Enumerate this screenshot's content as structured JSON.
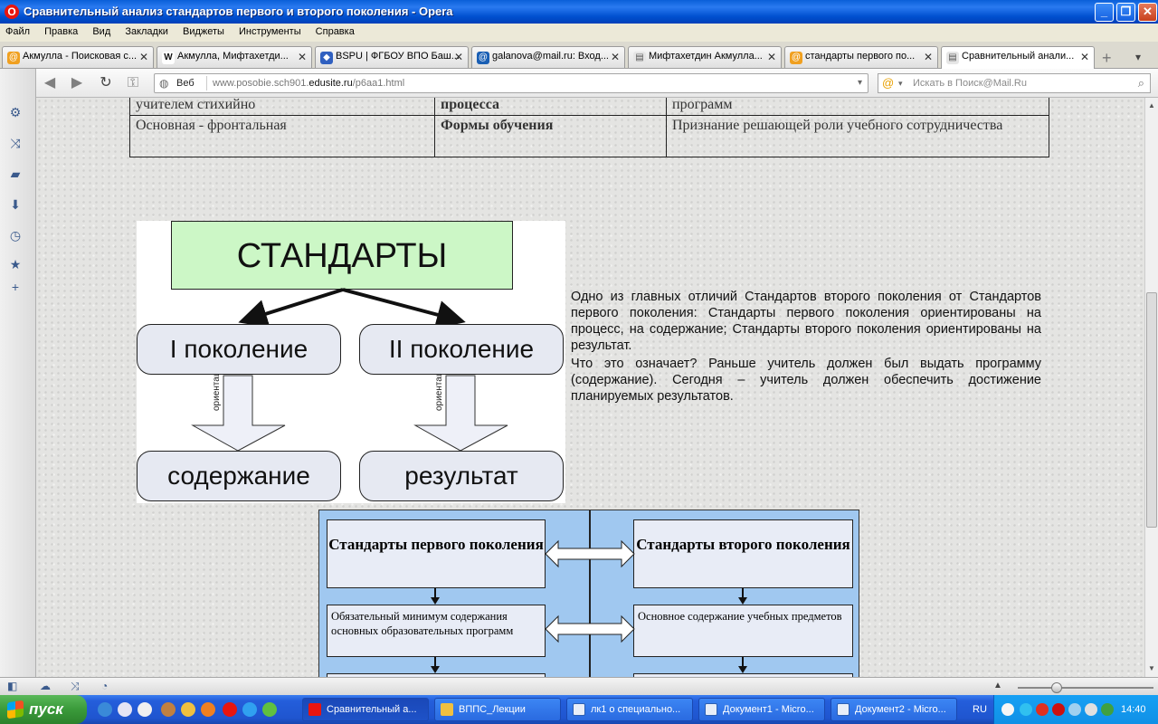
{
  "window": {
    "title": "Сравнительный анализ стандартов первого и второго поколения - Opera"
  },
  "menu": [
    "Файл",
    "Правка",
    "Вид",
    "Закладки",
    "Виджеты",
    "Инструменты",
    "Справка"
  ],
  "tabs": [
    {
      "label": "Акмулла - Поисковая с...",
      "icon_color": "#f0a020"
    },
    {
      "label": "Акмулла, Мифтахетди...",
      "icon_color": "#555555"
    },
    {
      "label": "BSPU | ФГБОУ ВПО Баш...",
      "icon_color": "#3060c0"
    },
    {
      "label": "galanova@mail.ru: Вход...",
      "icon_color": "#1a5fb4"
    },
    {
      "label": "Мифтахетдин Акмулла...",
      "icon_color": "#888888"
    },
    {
      "label": "стандарты первого по...",
      "icon_color": "#f0a020"
    },
    {
      "label": "Сравнительный анали...",
      "icon_color": "#888888"
    }
  ],
  "addressbar": {
    "web_label": "Веб",
    "url_pre": "www.posobie.sch901.",
    "url_host": "edusite.ru",
    "url_post": "/p6aa1.html",
    "search_placeholder": "Искать в Поиск@Mail.Ru"
  },
  "table": {
    "rows": [
      [
        "учителем стихийно",
        "процесса",
        "программ"
      ],
      [
        "Основная - фронтальная",
        "Формы обучения",
        "Признание решающей роли учебного сотрудничества"
      ]
    ]
  },
  "diagram": {
    "title": "СТАНДАРТЫ",
    "gen1": "I поколение",
    "gen2": "II поколение",
    "arrow_label": "ориентация",
    "result1": "содержание",
    "result2": "результат"
  },
  "description": {
    "p1": "Одно из главных отличий Стандартов второго поколения от Стандартов первого поколения: Стандарты первого поколения ориентированы на процесс, на содержание; Стандарты второго поколения ориентированы на результат.",
    "p2": "Что это означает? Раньше учитель должен был выдать программу (содержание). Сегодня – учитель должен обеспечить достижение планируемых результатов."
  },
  "comparison": {
    "left_header": "Стандарты первого поколения",
    "right_header": "Стандарты второго поколения",
    "left_item": "Обязательный минимум содержания основных образовательных программ",
    "right_item": "Основное содержание учебных предметов"
  },
  "taskbar": {
    "start_label": "пуск",
    "items": [
      {
        "label": "Сравнительный а...",
        "icon_color": "#e8150f"
      },
      {
        "label": "ВППС_Лекции",
        "icon_color": "#f0c040"
      },
      {
        "label": "лк1 о специально...",
        "icon_color": "#2b5fb3"
      },
      {
        "label": "Документ1 - Micro...",
        "icon_color": "#2b5fb3"
      },
      {
        "label": "Документ2 - Micro...",
        "icon_color": "#2b5fb3"
      }
    ],
    "lang": "RU",
    "clock": "14:40"
  }
}
